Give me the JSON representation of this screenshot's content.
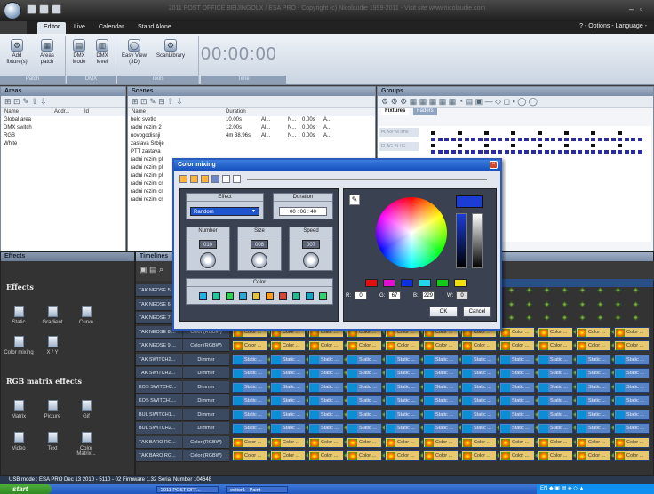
{
  "app": {
    "title": "2011 POST OFFICE BEIJINGOLX / ESA PRO - Copyright (c) Nicolaudie 1999-2011 - Visit site www.nicolaudie.com"
  },
  "tabs": [
    "Editor",
    "Live",
    "Calendar",
    "Stand Alone"
  ],
  "options_label": "? - Options - Language -",
  "ribbon": {
    "patch": {
      "label": "Patch",
      "buttons": [
        "Add fixture(s)",
        "Areas patch"
      ]
    },
    "dmx": {
      "label": "DMX",
      "buttons": [
        "DMX Mode",
        "DMX level"
      ]
    },
    "tools": {
      "label": "Tools",
      "buttons": [
        "Easy View (3D)",
        "ScanLibrary"
      ]
    },
    "time_label": "Time",
    "timer": "00:00:00"
  },
  "areas": {
    "title": "Areas",
    "headers": [
      "Name",
      "Addr...",
      "Id"
    ],
    "rows": [
      "Global area",
      "DMX switch",
      "RGB",
      "White"
    ]
  },
  "scenes": {
    "title": "Scenes",
    "headers": [
      "Name",
      "Duration"
    ],
    "rows": [
      {
        "name": "belo svetlo",
        "dur": "10.00s",
        "c": "Al...",
        "n": "N...",
        "t": "0.00s",
        "a": "A..."
      },
      {
        "name": "radni rezim 2",
        "dur": "12.00s",
        "c": "Al...",
        "n": "N...",
        "t": "0.00s",
        "a": "A..."
      },
      {
        "name": "novogodisnji",
        "dur": "4m 38.96s",
        "c": "Al...",
        "n": "N...",
        "t": "0.00s",
        "a": "A..."
      },
      {
        "name": "zastava Srbije",
        "dur": "",
        "c": "",
        "n": "",
        "t": "",
        "a": ""
      },
      {
        "name": "PTT zastava",
        "dur": "",
        "c": "",
        "n": "",
        "t": "",
        "a": ""
      },
      {
        "name": "radni rezim pl",
        "dur": "",
        "c": "",
        "n": "",
        "t": "",
        "a": ""
      },
      {
        "name": "radni rezim pl",
        "dur": "",
        "c": "",
        "n": "",
        "t": "",
        "a": ""
      },
      {
        "name": "radni rezim pl",
        "dur": "",
        "c": "",
        "n": "",
        "t": "",
        "a": ""
      },
      {
        "name": "radni rezim cr",
        "dur": "",
        "c": "",
        "n": "",
        "t": "",
        "a": ""
      },
      {
        "name": "radni rezim cr",
        "dur": "",
        "c": "",
        "n": "",
        "t": "",
        "a": ""
      },
      {
        "name": "radni rezim cr",
        "dur": "",
        "c": "",
        "n": "",
        "t": "",
        "a": ""
      }
    ]
  },
  "groups": {
    "title": "Groups",
    "tab_fixtures": "Fixtures",
    "tab_faders": "Faders",
    "labels": [
      "FLAG WHITE",
      "FLAG BLUE"
    ]
  },
  "effects": {
    "title": "Effects",
    "section1": "Effects",
    "items1": [
      "Static",
      "Gradient",
      "Curve",
      "Color mixing",
      "X / Y"
    ],
    "section2": "RGB matrix effects",
    "items2": [
      "Matrix",
      "Picture",
      "Gif",
      "Video",
      "Text",
      "Color Matrix..."
    ]
  },
  "timelines": {
    "title": "Timelines",
    "rows": [
      {
        "name": "TAK NEOSE 5",
        "type": ""
      },
      {
        "name": "TAK NEOSE 6",
        "type": ""
      },
      {
        "name": "TAK NEOSE 7",
        "type": ""
      },
      {
        "name": "TAK NEOSE 8 ...",
        "type": "Color (RGBW)",
        "kind": "color"
      },
      {
        "name": "TAK NEOSE 9 ...",
        "type": "Color (RGBW)",
        "kind": "color"
      },
      {
        "name": "TAK SWITCH2...",
        "type": "Dimmer",
        "kind": "static"
      },
      {
        "name": "TAK SWITCH2...",
        "type": "Dimmer",
        "kind": "static"
      },
      {
        "name": "KOS SWITCH2...",
        "type": "Dimmer",
        "kind": "static"
      },
      {
        "name": "KOS SWITCH1...",
        "type": "Dimmer",
        "kind": "static"
      },
      {
        "name": "BUL SWITCH1...",
        "type": "Dimmer",
        "kind": "static"
      },
      {
        "name": "BUL SWITCH2...",
        "type": "Dimmer",
        "kind": "static"
      },
      {
        "name": "TAK BARO RG...",
        "type": "Color (RGBW)",
        "kind": "color"
      },
      {
        "name": "TAK BARO RG...",
        "type": "Color (RGBW)",
        "kind": "color"
      }
    ],
    "static_label": "Static ...",
    "color_label": "Color ..."
  },
  "dialog": {
    "title": "Color mixing",
    "effect_label": "Effect",
    "effect_value": "Random",
    "duration_label": "Duration",
    "duration_value": "00 : 06 : 40",
    "number_label": "Number",
    "number_value": "010",
    "size_label": "Size",
    "size_value": "008",
    "speed_label": "Speed",
    "speed_value": "007",
    "color_label": "Color",
    "r_label": "R:",
    "r_value": "0",
    "g_label": "G:",
    "g_value": "67",
    "b_label": "B:",
    "b_value": "229",
    "w_label": "W:",
    "w_value": "0",
    "ok": "OK",
    "cancel": "Cancel",
    "color_swatches": [
      "#19b5e6",
      "#22c79a",
      "#2ed04d",
      "#28a7d8",
      "#e6c23c",
      "#ff9a1a",
      "#d8442e",
      "#25b78e",
      "#12a8c4",
      "#2bd66a"
    ],
    "preset_swatches": [
      "#e01010",
      "#e010d0",
      "#1030e0",
      "#20d8e8",
      "#12c818",
      "#f0e010"
    ]
  },
  "status": "USB mode : ESA PRO Dec 13 2010 - 5110 - 02 Firmware 1.32 Serial Number 104648",
  "taskbar": {
    "start": "start",
    "tasks": [
      "2011 POST OFF...",
      "editor1 - Paint"
    ]
  }
}
